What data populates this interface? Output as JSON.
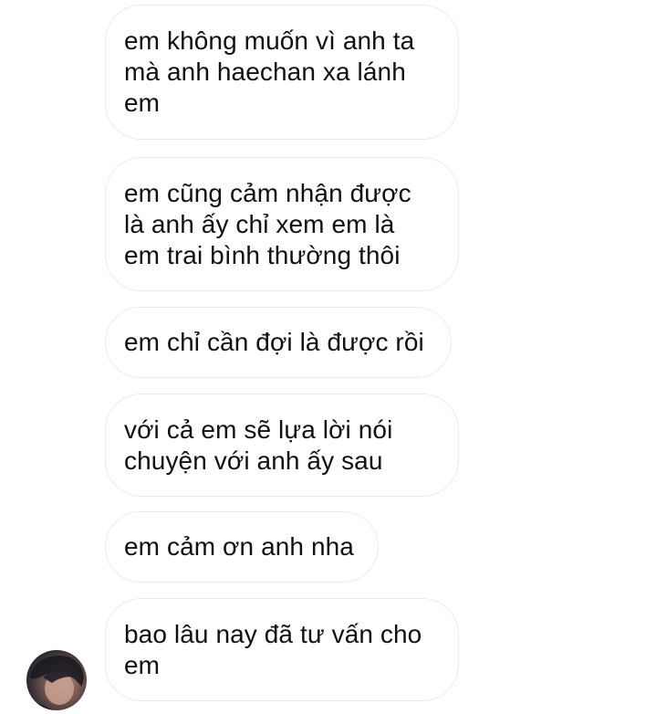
{
  "conversation": {
    "messages": [
      {
        "text": "em không muốn vì anh ta\nmà anh haechan xa lánh\nem"
      },
      {
        "text": "em cũng cảm nhận được\nlà anh ấy chỉ xem em là\nem trai bình thường thôi"
      },
      {
        "text": "em chỉ cần đợi là được rồi"
      },
      {
        "text": "với cả em sẽ lựa lời nói\nchuyện với anh ấy sau"
      },
      {
        "text": "em cảm ơn anh nha"
      },
      {
        "text": "bao lâu nay đã tư vấn cho\nem"
      }
    ],
    "sender_avatar": {
      "icon": "user-avatar-photo"
    }
  }
}
